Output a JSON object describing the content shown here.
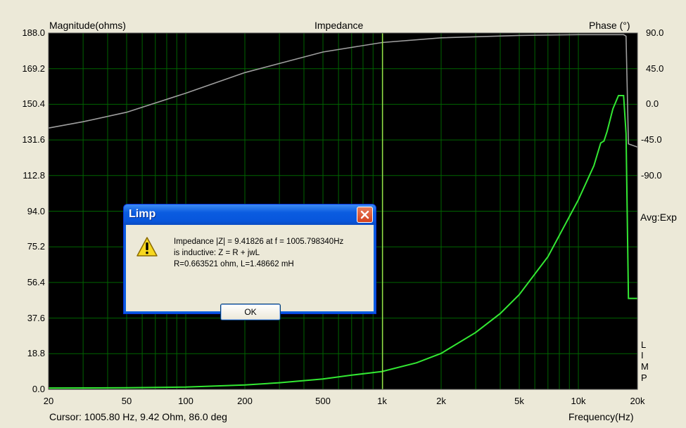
{
  "header": {
    "left_label": "Magnitude(ohms)",
    "title": "Impedance",
    "right_label": "Phase (°)"
  },
  "y_left_ticks": [
    "188.0",
    "169.2",
    "150.4",
    "131.6",
    "112.8",
    "94.0",
    "75.2",
    "56.4",
    "37.6",
    "18.8",
    "0.0"
  ],
  "y_right_ticks": [
    "90.0",
    "45.0",
    "0.0",
    "-45.0",
    "-90.0"
  ],
  "x_ticks": [
    {
      "f": 20,
      "label": "20"
    },
    {
      "f": 50,
      "label": "50"
    },
    {
      "f": 100,
      "label": "100"
    },
    {
      "f": 200,
      "label": "200"
    },
    {
      "f": 500,
      "label": "500"
    },
    {
      "f": 1000,
      "label": "1k"
    },
    {
      "f": 2000,
      "label": "2k"
    },
    {
      "f": 5000,
      "label": "5k"
    },
    {
      "f": 10000,
      "label": "10k"
    },
    {
      "f": 20000,
      "label": "20k"
    }
  ],
  "avg_label": "Avg:Exp",
  "side_label": [
    "L",
    "I",
    "M",
    "P"
  ],
  "footer": {
    "cursor": "Cursor: 1005.80 Hz, 9.42 Ohm, 86.0 deg",
    "xlabel": "Frequency(Hz)"
  },
  "colors": {
    "plot_bg": "#000000",
    "grid": "#006400",
    "magnitude": "#33e833",
    "phase": "#9e9e9e",
    "cursor": "#9be04a"
  },
  "chart_data": {
    "type": "line",
    "title": "Impedance",
    "xlabel": "Frequency(Hz)",
    "ylabel": "Magnitude(ohms)",
    "y2label": "Phase (°)",
    "x_scale": "log",
    "xlim": [
      20,
      20000
    ],
    "ylim": [
      0,
      188
    ],
    "y2lim": [
      -135,
      90
    ],
    "grid": true,
    "cursor_x": 1005.8,
    "series": [
      {
        "name": "",
        "axis": "left",
        "x": [
          20,
          50,
          100,
          200,
          300,
          500,
          700,
          1000,
          1500,
          2000,
          3000,
          4000,
          5000,
          7000,
          10000,
          12000,
          13000,
          13500,
          14000,
          15000,
          16000,
          17000,
          17500,
          18000,
          20000
        ],
        "y": [
          0.7,
          0.8,
          1.2,
          2.3,
          3.5,
          5.5,
          7.5,
          9.4,
          14,
          19,
          30,
          40,
          50,
          70,
          100,
          118,
          130,
          131,
          136,
          148,
          155,
          155,
          135,
          48,
          48
        ]
      },
      {
        "name": "",
        "axis": "right",
        "x": [
          20,
          30,
          50,
          100,
          200,
          500,
          1000,
          2000,
          5000,
          10000,
          16000,
          17000,
          17500,
          18000,
          20000
        ],
        "y": [
          30,
          34,
          40,
          52,
          65,
          78,
          84,
          87,
          88.5,
          89,
          89,
          89,
          88,
          20,
          18
        ]
      }
    ]
  },
  "dialog": {
    "title": "Limp",
    "line1": "Impedance  |Z|  = 9.41826 at f = 1005.798340Hz",
    "line2": "is inductive: Z = R + jwL",
    "line3": "R=0.663521 ohm, L=1.48662 mH",
    "ok_label": "OK"
  }
}
